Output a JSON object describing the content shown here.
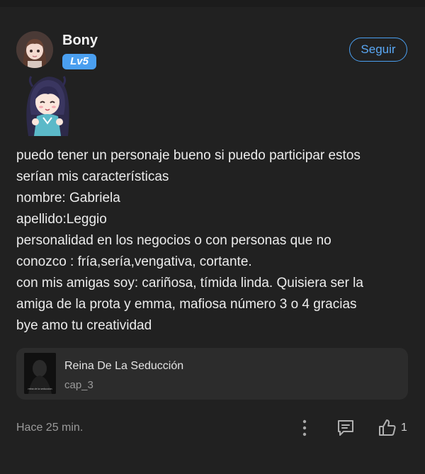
{
  "user": {
    "name": "Bony",
    "level": "Lv5"
  },
  "follow_label": "Seguir",
  "comment_lines": [
    "puedo tener un personaje bueno si puedo participar estos",
    "serían mis características",
    "nombre: Gabriela",
    "apellido:Leggio",
    "personalidad en los negocios o con personas que no",
    "conozco : fría,sería,vengativa, cortante.",
    "con mis amigas soy: cariñosa, tímida linda. Quisiera ser la",
    "amiga de la prota y emma, mafiosa número 3 o 4 gracias",
    "bye amo tu creatividad"
  ],
  "book": {
    "title": "Reina De La Seducción",
    "chapter": "cap_3",
    "cover_caption": "reina de la seduccion"
  },
  "timestamp": "Hace 25 min.",
  "likes": "1",
  "colors": {
    "background": "#212121",
    "accent": "#4a9ff0",
    "card": "#2c2c2c",
    "muted": "#9a9a9a"
  },
  "icons": [
    "avatar-girl",
    "sticker-anime-girl",
    "more-vertical-icon",
    "reply-icon",
    "thumbs-up-icon"
  ]
}
